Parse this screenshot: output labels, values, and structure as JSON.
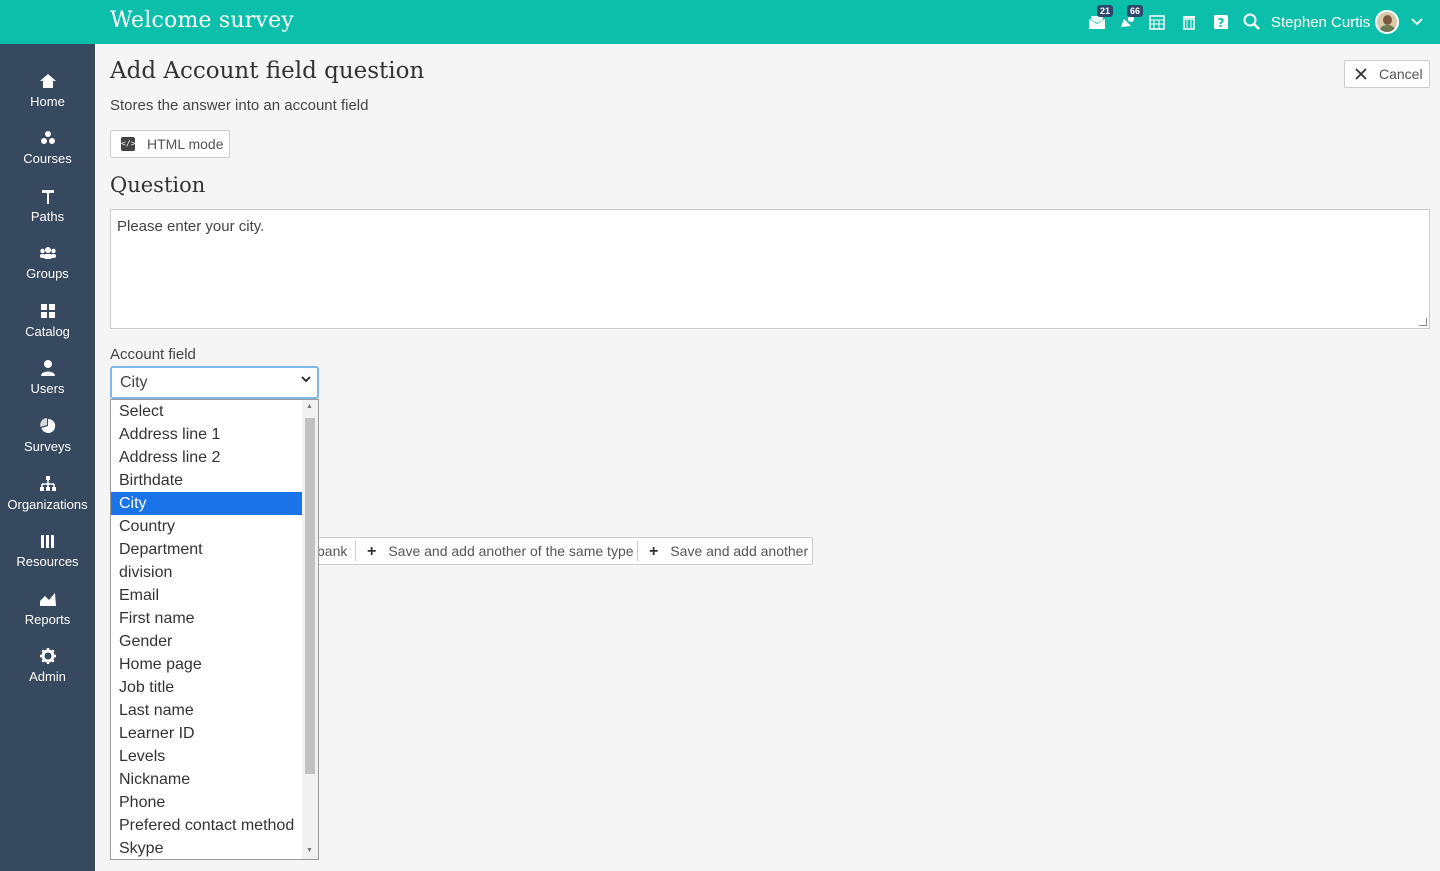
{
  "app": {
    "title": "Welcome survey",
    "notifications": {
      "messages_count": "21",
      "alerts_count": "66"
    },
    "user": {
      "name": "Stephen Curtis"
    }
  },
  "sidebar": {
    "items": [
      {
        "label": "Home",
        "icon": "home-icon"
      },
      {
        "label": "Courses",
        "icon": "courses-icon"
      },
      {
        "label": "Paths",
        "icon": "paths-icon"
      },
      {
        "label": "Groups",
        "icon": "groups-icon"
      },
      {
        "label": "Catalog",
        "icon": "catalog-icon"
      },
      {
        "label": "Users",
        "icon": "users-icon"
      },
      {
        "label": "Surveys",
        "icon": "surveys-icon"
      },
      {
        "label": "Organizations",
        "icon": "organizations-icon"
      },
      {
        "label": "Resources",
        "icon": "resources-icon"
      },
      {
        "label": "Reports",
        "icon": "reports-icon"
      },
      {
        "label": "Admin",
        "icon": "admin-icon"
      }
    ]
  },
  "page": {
    "title": "Add Account field question",
    "subtitle": "Stores the answer into an account field",
    "cancel_label": "Cancel",
    "html_mode_label": "HTML mode",
    "question_section": "Question",
    "question_text": "Please enter your city.",
    "account_field_label": "Account field",
    "account_field_value": "City"
  },
  "actions": {
    "bank_partial": "bank",
    "save_same_type": "Save and add another of the same type",
    "save_another": "Save and add another"
  },
  "dropdown": {
    "options": [
      "Select",
      "Address line 1",
      "Address line 2",
      "Birthdate",
      "City",
      "Country",
      "Department",
      "division",
      "Email",
      "First name",
      "Gender",
      "Home page",
      "Job title",
      "Last name",
      "Learner ID",
      "Levels",
      "Nickname",
      "Phone",
      "Prefered contact method",
      "Skype"
    ],
    "selected": "City"
  },
  "colors": {
    "topbar": "#0bbfaa",
    "sidebar": "#36495e",
    "selected": "#1a73e8"
  }
}
